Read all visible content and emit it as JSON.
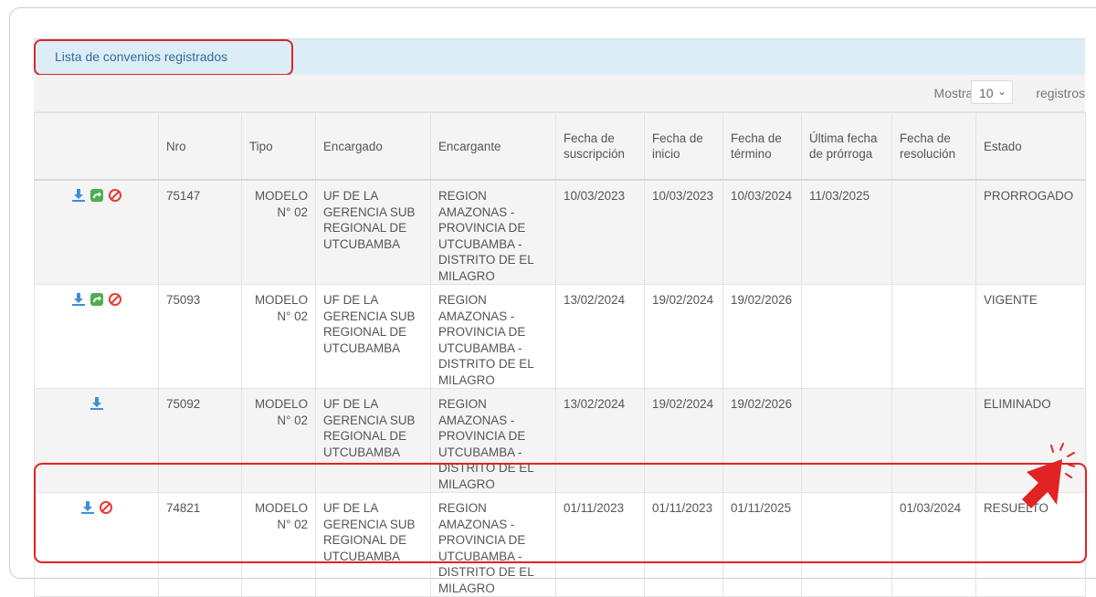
{
  "panel": {
    "title": "Lista de convenios registrados",
    "show_label": "Mostrar",
    "page_size": "10",
    "records_label": "registros"
  },
  "columns": [
    "",
    "Nro",
    "Tipo",
    "Encargado",
    "Encargante",
    "Fecha de suscripción",
    "Fecha de inicio",
    "Fecha de término",
    "Última fecha de prórroga",
    "Fecha de resolución",
    "Estado"
  ],
  "rows": [
    {
      "actions": [
        "download-icon",
        "renew-icon",
        "cancel-icon"
      ],
      "nro": "75147",
      "tipo": "MODELO N° 02",
      "encargado": "UF DE LA GERENCIA SUB REGIONAL DE UTCUBAMBA",
      "encargante": "REGION AMAZONAS - PROVINCIA DE UTCUBAMBA - DISTRITO DE EL MILAGRO",
      "suscripcion": "10/03/2023",
      "inicio": "10/03/2023",
      "termino": "10/03/2024",
      "prorroga": "11/03/2025",
      "resolucion": "",
      "estado": "PRORROGADO"
    },
    {
      "actions": [
        "download-icon",
        "renew-icon",
        "cancel-icon"
      ],
      "nro": "75093",
      "tipo": "MODELO N° 02",
      "encargado": "UF DE LA GERENCIA SUB REGIONAL DE UTCUBAMBA",
      "encargante": "REGION AMAZONAS - PROVINCIA DE UTCUBAMBA - DISTRITO DE EL MILAGRO",
      "suscripcion": "13/02/2024",
      "inicio": "19/02/2024",
      "termino": "19/02/2026",
      "prorroga": "",
      "resolucion": "",
      "estado": "VIGENTE"
    },
    {
      "actions": [
        "download-icon"
      ],
      "nro": "75092",
      "tipo": "MODELO N° 02",
      "encargado": "UF DE LA GERENCIA SUB REGIONAL DE UTCUBAMBA",
      "encargante": "REGION AMAZONAS - PROVINCIA DE UTCUBAMBA - DISTRITO DE EL MILAGRO",
      "suscripcion": "13/02/2024",
      "inicio": "19/02/2024",
      "termino": "19/02/2026",
      "prorroga": "",
      "resolucion": "",
      "estado": "ELIMINADO"
    },
    {
      "actions": [
        "download-icon",
        "cancel-icon"
      ],
      "nro": "74821",
      "tipo": "MODELO N° 02",
      "encargado": "UF DE LA GERENCIA SUB REGIONAL DE UTCUBAMBA",
      "encargante": "REGION AMAZONAS - PROVINCIA DE UTCUBAMBA - DISTRITO DE EL MILAGRO",
      "suscripcion": "01/11/2023",
      "inicio": "01/11/2023",
      "termino": "01/11/2025",
      "prorroga": "",
      "resolucion": "01/03/2024",
      "estado": "RESUELTO"
    }
  ],
  "colors": {
    "download": "#3d8fd8",
    "renew": "#4caf50",
    "cancel": "#e53935",
    "highlight": "#e02424",
    "header_bg": "#dcedf7"
  }
}
